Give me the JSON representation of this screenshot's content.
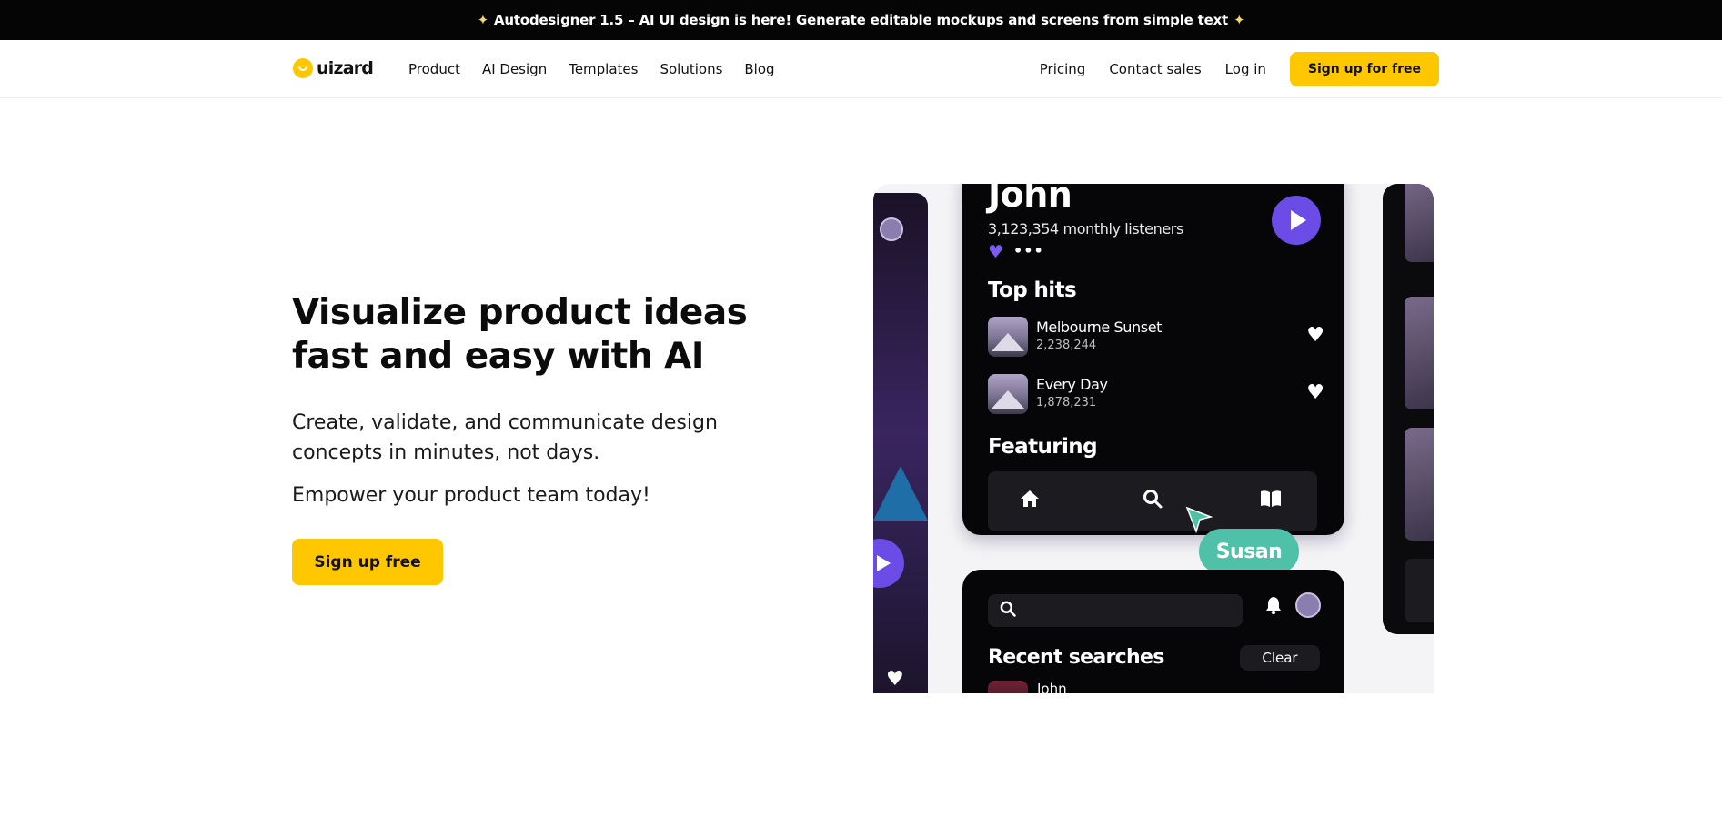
{
  "banner": {
    "text": "Autodesigner 1.5 – AI UI design is here! Generate editable mockups and screens from simple text",
    "icon": "magic-wand-icon"
  },
  "nav": {
    "logo": "uizard",
    "left_links": [
      "Product",
      "AI Design",
      "Templates",
      "Solutions",
      "Blog"
    ],
    "right_links": [
      "Pricing",
      "Contact sales",
      "Log in"
    ],
    "cta": "Sign up for free"
  },
  "hero": {
    "title": "Visualize product ideas fast and easy with AI",
    "subtitle": "Create, validate, and communicate design concepts in minutes, not days.",
    "subtitle2": "Empower your product team today!",
    "cta": "Sign up free"
  },
  "showcase": {
    "artist_name": "John",
    "monthly_listeners": "3,123,354 monthly listeners",
    "top_hits_heading": "Top hits",
    "tracks": [
      {
        "title": "Melbourne Sunset",
        "count": "2,238,244"
      },
      {
        "title": "Every Day",
        "count": "1,878,231"
      }
    ],
    "featuring_heading": "Featuring",
    "tab_icons": [
      "home-icon",
      "search-icon",
      "book-icon"
    ],
    "cursor_label": "Susan",
    "recent_heading": "Recent searches",
    "clear_label": "Clear",
    "recent_item": "John",
    "colors": {
      "accent_purple": "#6b4ce6",
      "cursor_teal": "#4fc1a8",
      "brand_yellow": "#ffc700"
    }
  }
}
